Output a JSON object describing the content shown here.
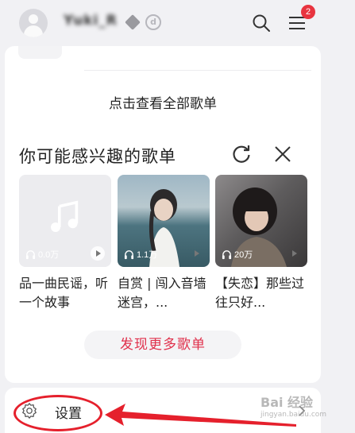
{
  "header": {
    "username": "Yuki_R",
    "level_badge": "d",
    "notification_count": "2"
  },
  "card": {
    "view_all_label": "点击查看全部歌单",
    "section_title": "你可能感兴趣的歌单",
    "playlists": [
      {
        "play_count": "0.0万",
        "title": "品一曲民谣，听一个故事"
      },
      {
        "play_count": "1.1万",
        "title": "自赏 | 闯入音墙迷宫，..."
      },
      {
        "play_count": "20万",
        "title": "【失恋】那些过往只好..."
      }
    ],
    "discover_label": "发现更多歌单"
  },
  "settings": {
    "label": "设置"
  },
  "watermark": {
    "text": "Bai 经验",
    "sub": "jingyan.baidu.com"
  },
  "colors": {
    "accent": "#e0314c",
    "badge": "#e8343f",
    "annotation": "#e5202c",
    "background": "#f1f1f4"
  },
  "icons": [
    "avatar-icon",
    "vip-icon",
    "search-icon",
    "menu-icon",
    "refresh-icon",
    "close-icon",
    "headphone-icon",
    "play-icon",
    "music-note-icon",
    "gear-icon",
    "chevron-right-icon"
  ]
}
